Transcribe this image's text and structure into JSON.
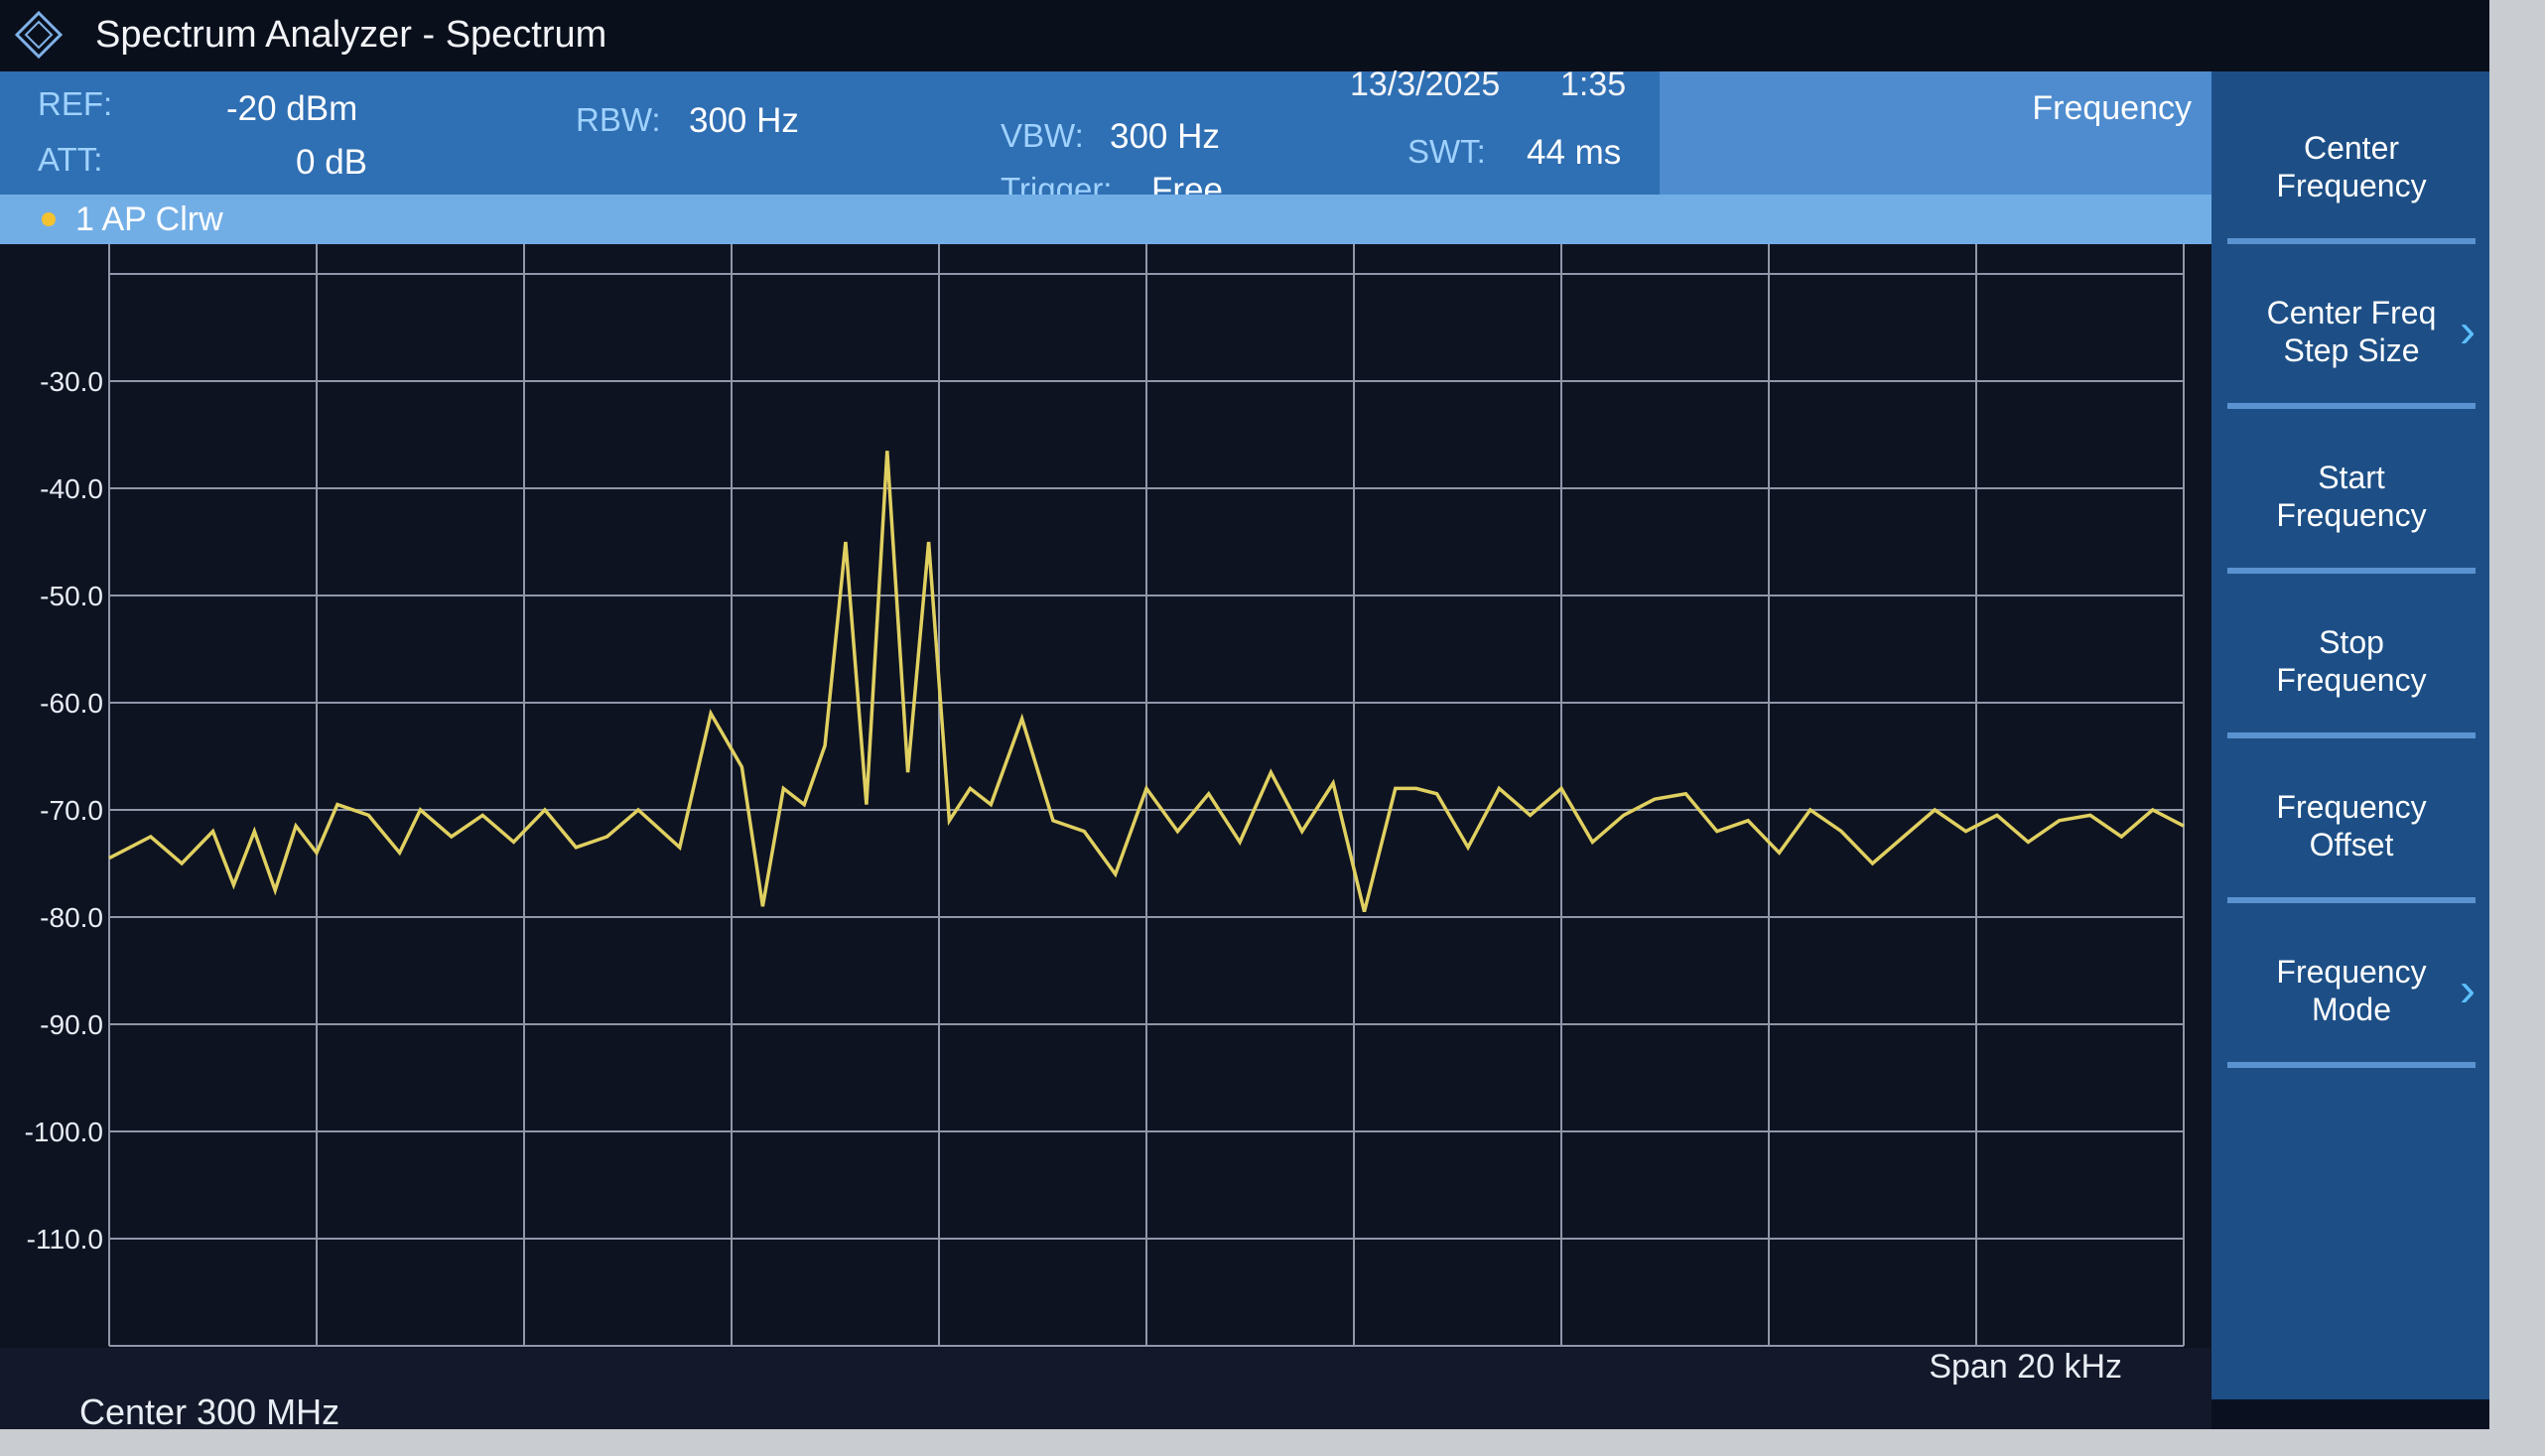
{
  "window": {
    "title": "Spectrum Analyzer - Spectrum",
    "date": "13/3/2025",
    "time": "1:35"
  },
  "settings": {
    "ref_label": "REF:",
    "ref_value": "-20 dBm",
    "att_label": "ATT:",
    "att_value": "0 dB",
    "rbw_label": "RBW:",
    "rbw_value": "300 Hz",
    "vbw_label": "VBW:",
    "vbw_value": "300 Hz",
    "trigger_label": "Trigger:",
    "trigger_value": "Free",
    "swt_label": "SWT:",
    "swt_value": "44 ms"
  },
  "trace": {
    "label": "1 AP  Clrw",
    "color": "#e0d060",
    "dot_color": "#f2c230"
  },
  "softkey_panel": {
    "title": "Frequency",
    "keys": [
      {
        "label": "Center\nFrequency",
        "has_submenu": false
      },
      {
        "label": "Center Freq\nStep Size",
        "has_submenu": true
      },
      {
        "label": "Start\nFrequency",
        "has_submenu": false
      },
      {
        "label": "Stop\nFrequency",
        "has_submenu": false
      },
      {
        "label": "Frequency\nOffset",
        "has_submenu": false
      },
      {
        "label": "Frequency\nMode",
        "has_submenu": true
      }
    ]
  },
  "footer": {
    "center": "Center 300 MHz",
    "span": "Span 20 kHz"
  },
  "chart_data": {
    "type": "line",
    "ylabel": "",
    "xlabel": "",
    "y_ticks": [
      "-30.0",
      "-40.0",
      "-50.0",
      "-60.0",
      "-70.0",
      "-80.0",
      "-90.0",
      "-100.0",
      "-110.0"
    ],
    "ylim": [
      -120,
      -20
    ],
    "xlim": [
      -10,
      10
    ],
    "x_unit": "kHz offset",
    "grid": true,
    "series": [
      {
        "x": [
          -10.0,
          -9.6,
          -9.3,
          -9.0,
          -8.8,
          -8.6,
          -8.4,
          -8.2,
          -8.0,
          -7.8,
          -7.5,
          -7.2,
          -7.0,
          -6.7,
          -6.4,
          -6.1,
          -5.8,
          -5.5,
          -5.2,
          -4.9,
          -4.5,
          -4.2,
          -3.9,
          -3.7,
          -3.5,
          -3.3,
          -3.1,
          -2.9,
          -2.7,
          -2.5,
          -2.3,
          -2.1,
          -1.9,
          -1.7,
          -1.5,
          -1.2,
          -0.9,
          -0.6,
          -0.3,
          0.0,
          0.3,
          0.6,
          0.9,
          1.2,
          1.5,
          1.8,
          2.1,
          2.4,
          2.6,
          2.8,
          3.1,
          3.4,
          3.7,
          4.0,
          4.3,
          4.6,
          4.9,
          5.2,
          5.5,
          5.8,
          6.1,
          6.4,
          6.7,
          7.0,
          7.3,
          7.6,
          7.9,
          8.2,
          8.5,
          8.8,
          9.1,
          9.4,
          9.7,
          10.0
        ],
        "y": [
          -74.5,
          -72.5,
          -75.0,
          -72.0,
          -77.0,
          -72.0,
          -77.5,
          -71.5,
          -74.0,
          -69.5,
          -70.5,
          -74.0,
          -70.0,
          -72.5,
          -70.5,
          -73.0,
          -70.0,
          -73.5,
          -72.5,
          -70.0,
          -73.5,
          -61.0,
          -66.0,
          -79.0,
          -68.0,
          -69.5,
          -64.0,
          -45.0,
          -69.5,
          -36.5,
          -66.5,
          -45.0,
          -71.0,
          -68.0,
          -69.5,
          -61.5,
          -71.0,
          -72.0,
          -76.0,
          -68.0,
          -72.0,
          -68.5,
          -73.0,
          -66.5,
          -72.0,
          -67.5,
          -79.5,
          -68.0,
          -68.0,
          -68.5,
          -73.5,
          -68.0,
          -70.5,
          -68.0,
          -73.0,
          -70.5,
          -69.0,
          -68.5,
          -72.0,
          -71.0,
          -74.0,
          -70.0,
          -72.0,
          -75.0,
          -72.5,
          -70.0,
          -72.0,
          -70.5,
          -73.0,
          -71.0,
          -70.5,
          -72.5,
          -70.0,
          -71.5
        ]
      }
    ]
  }
}
